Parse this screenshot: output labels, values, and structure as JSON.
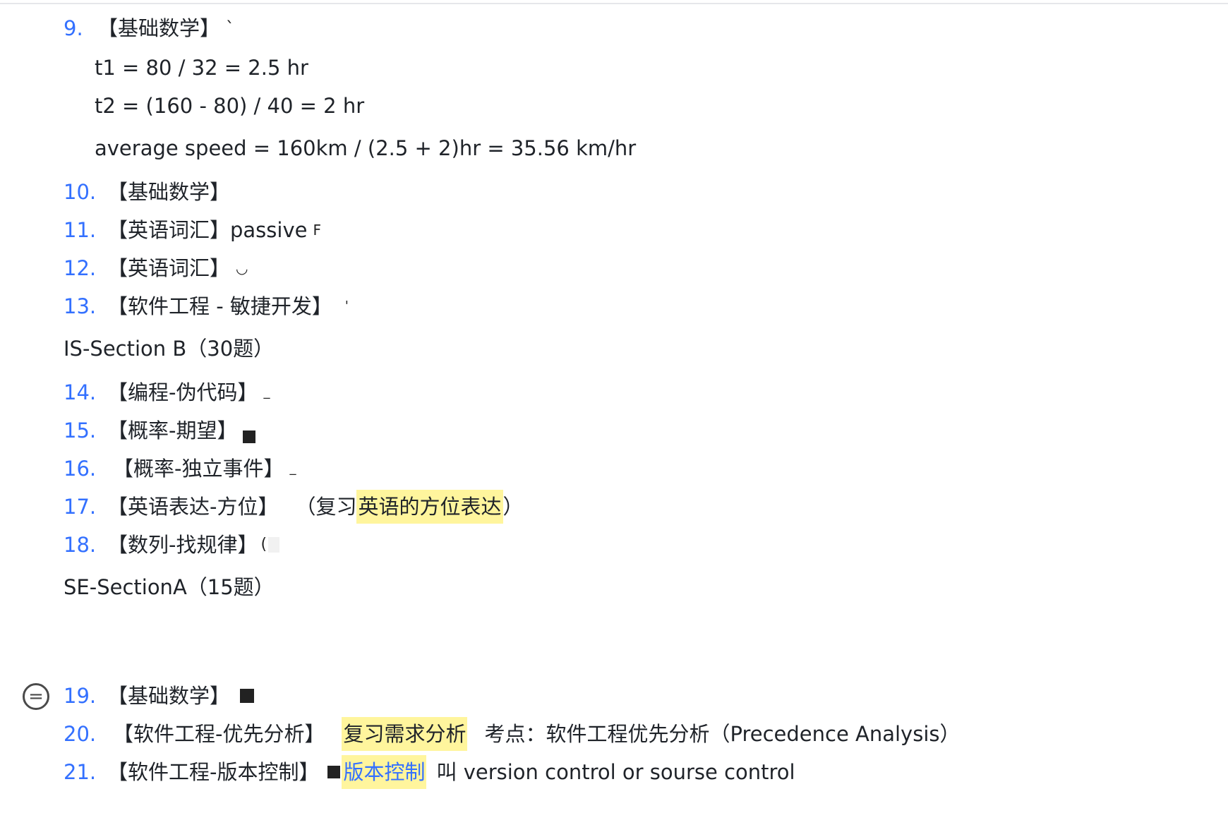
{
  "items": {
    "q9": {
      "number": "9.",
      "text": "【基础数学】",
      "trail": "`"
    },
    "q9_lines": [
      "t1 = 80 / 32 = 2.5 hr",
      "t2 = (160 - 80) / 40 = 2 hr",
      "average speed = 160km / (2.5 + 2)hr = 35.56 km/hr"
    ],
    "q10": {
      "number": "10.",
      "text": "【基础数学】"
    },
    "q11": {
      "number": "11.",
      "text": "【英语词汇】passive",
      "trail": "F"
    },
    "q12": {
      "number": "12.",
      "text": "【英语词汇】",
      "trail": "◡"
    },
    "q13": {
      "number": "13.",
      "text": "【软件工程 - 敏捷开发】",
      "trail": "'"
    },
    "section_b": "IS-Section B（30题）",
    "q14": {
      "number": "14.",
      "text": "【编程-伪代码】",
      "trail": "_"
    },
    "q15": {
      "number": "15.",
      "text": "【概率-期望】"
    },
    "q16": {
      "number": "16.",
      "text": "【概率-独立事件】",
      "trail": "_"
    },
    "q17": {
      "number": "17.",
      "text": "【英语表达-方位】",
      "paren_open": "（复习",
      "highlight": "英语的方位表达",
      "paren_close": "）"
    },
    "q18": {
      "number": "18.",
      "text": "【数列-找规律】",
      "trail": "("
    },
    "section_se": "SE-SectionA（15题）",
    "q19": {
      "number": "19.",
      "text": "【基础数学】"
    },
    "q20": {
      "number": "20.",
      "text": "【软件工程-优先分析】",
      "highlight": "复习需求分析",
      "note": "考点：软件工程优先分析（Precedence Analysis）"
    },
    "q21": {
      "number": "21.",
      "text": "【软件工程-版本控制】",
      "highlight_link": "版本控制",
      "note": "叫 version control or sourse control"
    }
  },
  "icons": {
    "comment": "comment-equals-icon"
  },
  "colors": {
    "number": "#3370ff",
    "highlight": "#fff59d",
    "text": "#1f2329"
  }
}
